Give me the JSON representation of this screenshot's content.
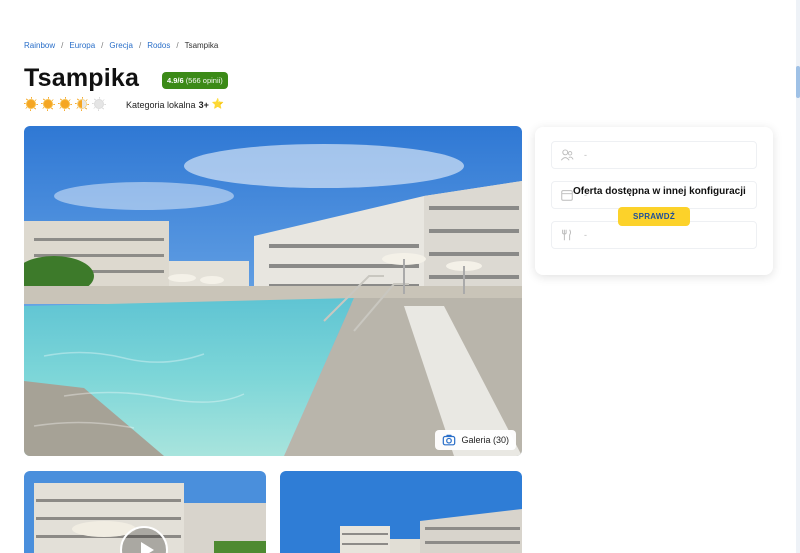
{
  "breadcrumb": {
    "items": [
      "Rainbow",
      "Europa",
      "Grecja",
      "Rodos"
    ],
    "current": "Tsampika",
    "separator": "/"
  },
  "hotel": {
    "name": "Tsampika",
    "rating_score": "4.9/6",
    "rating_count": "(566 opinii)",
    "sun_rating": 3.5,
    "sun_rating_max": 5,
    "category_label": "Kategoria lokalna",
    "category_value": "3+",
    "category_star": "⭐"
  },
  "gallery": {
    "button_label": "Galeria (30)",
    "icon": "camera-icon"
  },
  "booking": {
    "participants_placeholder": "-",
    "date_placeholder": "-",
    "board_placeholder": "-",
    "message": "Oferta dostępna w innej konfiguracji",
    "check_button": "SPRAWDŹ"
  },
  "colors": {
    "link": "#2a6fc9",
    "rating_badge": "#3b8a17",
    "button_bg": "#fcd22a",
    "button_text": "#1e4f9a"
  }
}
